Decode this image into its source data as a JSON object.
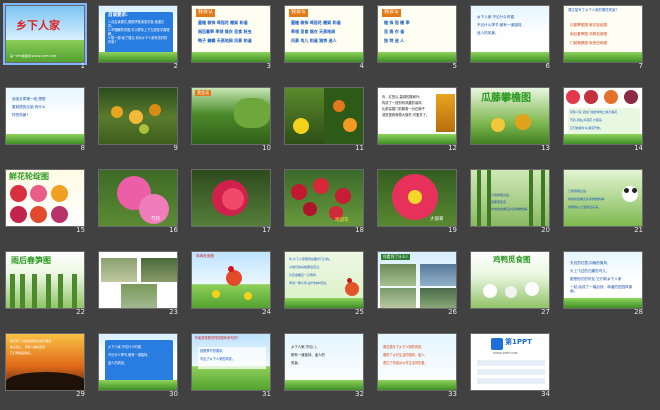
{
  "window": {
    "title": "乡下人家 PPT 幻灯片浏览"
  },
  "slides": [
    {
      "number": "1",
      "kind": "title",
      "title": "乡下人家",
      "caption": "第一PPT模板网-WWW.1PPT.COM"
    },
    {
      "number": "2",
      "kind": "text-blue",
      "heading": "自读要求:",
      "lines": [
        "1.自由读课文,借助拼音读准字音,读通文章。",
        "2.不理解的词语,可以联系上下文或查字典理解。",
        "3.想一想:读了课文,你对乡下人家有怎样的印象?"
      ]
    },
    {
      "number": "3",
      "kind": "words",
      "heading": "我会认",
      "lines": [
        "屋檐 装饰 鸡冠花 棚架 和谐",
        "雨后春笋 率领 捣衣 觅食 秋虫",
        "鸭子 蝴蝶 天高地阔 风景 和谐"
      ]
    },
    {
      "number": "4",
      "kind": "words",
      "heading": "我会写",
      "lines": [
        "屋檐 装饰 鸡冠花 棚架 和谐",
        "率领 觅食 捣衣 天高地阔",
        "风景 鸟儿 和谐 独特 迷人"
      ]
    },
    {
      "number": "5",
      "kind": "words",
      "heading": "我会写",
      "lines": [
        "檐 饰 冠 棚 率",
        "觅 捣 衣 谐",
        "独 特 迷 人"
      ]
    },
    {
      "number": "6",
      "kind": "text-plain",
      "lines": [
        "乡下人家,不论什么时候,",
        "不论什么季节,都有一道独特、",
        "迷人的风景。"
      ]
    },
    {
      "number": "7",
      "kind": "pairs",
      "heading": "课文描写了乡下人家的哪些风景?",
      "lines": [
        "瓜藤攀檐图 鲜花轮绽图",
        "雨后春笋图 鸡鸭觅食图",
        "门前晚餐图 秋夜虫鸣图"
      ]
    },
    {
      "number": "8",
      "kind": "text-plain",
      "lines": [
        "读读文章第一段,想想",
        "屋前搭的瓜架,有什么",
        "样的风景?"
      ]
    },
    {
      "number": "9",
      "kind": "photo-gourds"
    },
    {
      "number": "10",
      "kind": "photo-garden",
      "caption": "我会读"
    },
    {
      "number": "11",
      "kind": "photo-fruits"
    },
    {
      "number": "12",
      "kind": "poem",
      "lines": [
        "青、红的瓜,碧绿的藤和叶,",
        "构成了一道别有风趣的装饰,",
        "比那高楼门前蹲着一对石狮子",
        "或是竖着两根大旗杆,可爱多了。"
      ]
    },
    {
      "number": "13",
      "kind": "title-photo",
      "title": "瓜藤攀檐图"
    },
    {
      "number": "14",
      "kind": "flowers-text",
      "lines": [
        "有些人家,还在门前的场地上种几株花,",
        "芍药,凤仙,鸡冠花,大丽菊,",
        "它们依着时令,顺序开放。"
      ]
    },
    {
      "number": "15",
      "kind": "title-flowers",
      "title": "鲜花轮绽图"
    },
    {
      "number": "16",
      "kind": "photo-peony",
      "caption": "芍药"
    },
    {
      "number": "17",
      "kind": "photo-balsam",
      "caption": "凤仙"
    },
    {
      "number": "18",
      "kind": "photo-cockscomb",
      "caption": "鸡冠花"
    },
    {
      "number": "19",
      "kind": "photo-dahlia",
      "caption": "大丽菊"
    },
    {
      "number": "20",
      "kind": "bamboo-text",
      "lines": [
        "几场春雨过后,",
        "到那里走走,",
        "你常常会看见许多鲜嫩的笋。"
      ]
    },
    {
      "number": "21",
      "kind": "panda-text",
      "lines": [
        "几场春雨过后,",
        "你常常会看见许多鲜嫩的笋,",
        "成群地从土里探出头来。"
      ]
    },
    {
      "number": "22",
      "kind": "title-bamboo",
      "title": "雨后春笋图"
    },
    {
      "number": "23",
      "kind": "photo-chicks"
    },
    {
      "number": "24",
      "kind": "rooster",
      "caption": "鸡鸭觅食图"
    },
    {
      "number": "25",
      "kind": "text-green",
      "lines": [
        "鸡,乡下人家照例总要养几只的。",
        "从他们的房前屋后走过,",
        "肯定会瞧见一只母鸡,",
        "率领一群小鸡,在竹林中觅食。"
      ]
    },
    {
      "number": "26",
      "kind": "duck-photos",
      "heading": "你看到了什么?"
    },
    {
      "number": "27",
      "kind": "title-ducks",
      "title": "鸡鸭觅食图"
    },
    {
      "number": "28",
      "kind": "text-plain",
      "lines": [
        "天边的红霞,向晚的微风,",
        "头上飞过的归巢的鸟儿,",
        "都是他们的好友,它们和乡下人家",
        "一起,绘成了一幅自然、和谐的田园风景画。"
      ]
    },
    {
      "number": "29",
      "kind": "sunset-text",
      "lines": [
        "秋天到了,纺织娘寄住在他们屋前",
        "的瓜架上。月明人静的夜里,",
        "它们便唱起歌来。"
      ]
    },
    {
      "number": "30",
      "kind": "text-blue",
      "heading": "",
      "lines": [
        "乡下人家,不论什么时候,",
        "不论什么季节,都有一道独特、",
        "迷人的风景。"
      ]
    },
    {
      "number": "31",
      "kind": "meadow",
      "heading": "作者是按照怎样的顺序来写的?",
      "lines": [
        "按照季节的顺序,",
        "写出了乡下人家的风景。"
      ]
    },
    {
      "number": "32",
      "kind": "fill",
      "lines": [
        "乡下人家,不论(   ),",
        "都有一道独特、迷人的",
        "风景。"
      ]
    },
    {
      "number": "33",
      "kind": "text-summary",
      "lines": [
        "课文描写了乡下人家的风景,",
        "展现了乡村生活的独特、迷人,",
        "表达了作者对乡村生活的热爱。"
      ]
    },
    {
      "number": "34",
      "kind": "logo",
      "title": "第1PPT",
      "caption": "WWW.1PPT.COM"
    }
  ]
}
